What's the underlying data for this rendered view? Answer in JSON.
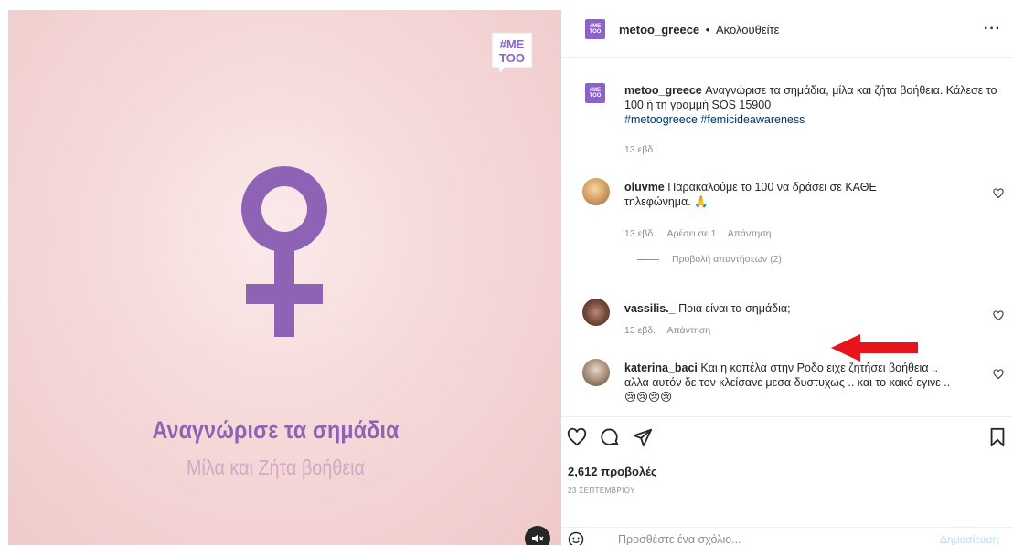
{
  "media": {
    "logo_text_top": "#ME",
    "logo_text_bottom": "TOO",
    "title": "Αναγνώρισε τα σημάδια",
    "subtitle": "Μίλα και Ζήτα βοήθεια",
    "symbol_color": "#8e63b5",
    "mute_icon": "muted-speaker-icon"
  },
  "header": {
    "username": "metoo_greece",
    "separator": "•",
    "follow_status": "Ακολουθείτε",
    "more_label": "···"
  },
  "caption": {
    "username": "metoo_greece",
    "text": "Αναγνώρισε τα σημάδια, μίλα και ζήτα βοήθεια. Κάλεσε το 100 ή τη γραμμή SOS 15900",
    "hashtags": [
      "#metoogreece",
      "#femicideawareness"
    ],
    "time": "13 εβδ."
  },
  "comments": [
    {
      "username": "oluvme",
      "text": "Παρακαλούμε το 100 να δράσει σε ΚΑΘΕ τηλεφώνημα. 🙏",
      "time": "13 εβδ.",
      "likes": "Αρέσει σε 1",
      "reply": "Απάντηση",
      "view_replies": "Προβολή απαντήσεων (2)"
    },
    {
      "username": "vassilis._",
      "text": "Ποια είναι τα σημάδια;",
      "time": "13 εβδ.",
      "reply": "Απάντηση"
    },
    {
      "username": "katerina_baci",
      "text": "Και η κοπέλα στην Ροδο ειχε ζητήσει βοήθεια .. αλλα αυτόν δε τον κλείσανε μεσα δυστυχως .. και το κακό εγινε .. 😢😢😢😢"
    }
  ],
  "actions": {
    "views": "2,612 προβολές",
    "date": "23 ΣΕΠΤΕΜΒΡΙΟΥ"
  },
  "comment_box": {
    "placeholder": "Προσθέστε ένα σχόλιο...",
    "post_label": "Δημοσίευση"
  },
  "colors": {
    "brand_purple": "#8a63c7",
    "arrow_red": "#e8141b",
    "link_blue": "#00376b",
    "post_disabled": "#b2dffc"
  }
}
